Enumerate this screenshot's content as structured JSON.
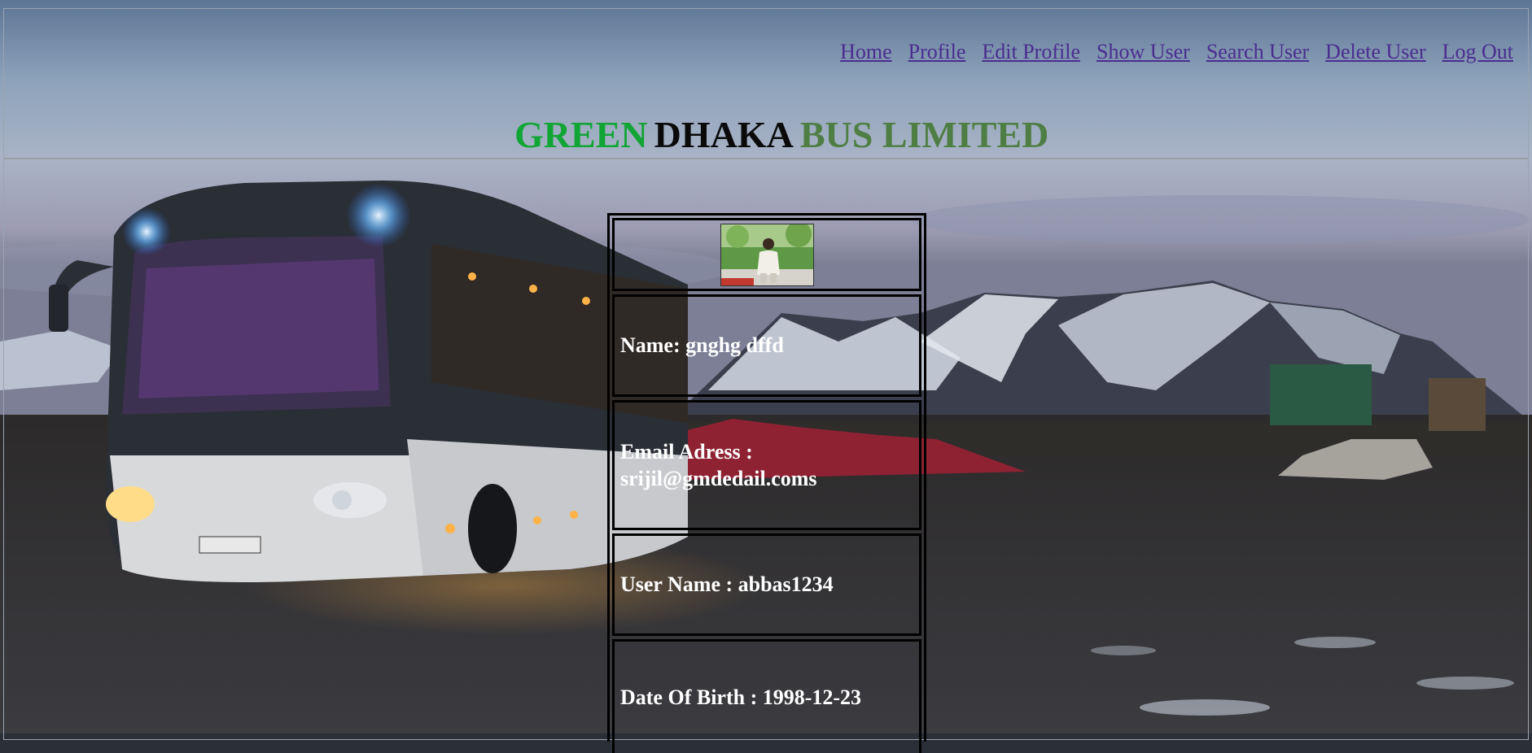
{
  "nav": {
    "items": [
      {
        "label": "Home"
      },
      {
        "label": "Profile"
      },
      {
        "label": "Edit Profile"
      },
      {
        "label": "Show User"
      },
      {
        "label": "Search User"
      },
      {
        "label": "Delete User"
      },
      {
        "label": "Log Out"
      }
    ]
  },
  "brand": {
    "part1": "GREEN",
    "part2": "DHAKA",
    "part3": "BUS LIMITED",
    "colors": {
      "part1": "#11a535",
      "part2": "#0a0a0a",
      "part3": "#4f7e44"
    }
  },
  "profile": {
    "photo_icon": "user-photo",
    "name": "Name: gnghg dffd",
    "email_label": "Email Adress :",
    "email_value": "srijil@gmdedail.coms",
    "username": "User Name : abbas1234",
    "dob": "Date Of Birth : 1998-12-23"
  },
  "colors": {
    "nav_link": "#4a2d8f",
    "cell_text": "#ffffff",
    "border": "#000000"
  }
}
